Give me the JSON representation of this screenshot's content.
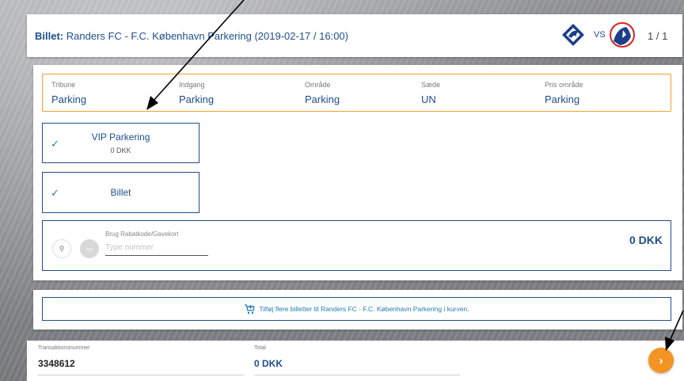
{
  "header": {
    "label": "Billet:",
    "event": "Randers FC - F.C. København Parkering (2019-02-17 / 16:00)",
    "vs": "VS",
    "page_count": "1 / 1"
  },
  "info": [
    {
      "label": "Tribune",
      "value": "Parking"
    },
    {
      "label": "Indgang",
      "value": "Parking"
    },
    {
      "label": "Område",
      "value": "Parking"
    },
    {
      "label": "Sæde",
      "value": "UN"
    },
    {
      "label": "Pris område",
      "value": "Parking"
    }
  ],
  "options": [
    {
      "name": "VIP Parkering",
      "price": "0 DKK"
    },
    {
      "name": "Billet"
    }
  ],
  "discount": {
    "label": "Brug Rabatkode/Gavekort",
    "placeholder": "Type nummer",
    "total": "0 DKK"
  },
  "add_more": {
    "text": "Tilføj flere billetter til Randers FC - F.C. København Parkering i kurven."
  },
  "footer": {
    "transaction_label": "Transaktionsnummer",
    "transaction_value": "3348612",
    "total_label": "Total",
    "total_value": "0 DKK"
  },
  "colors": {
    "accent": "#1f4e8c",
    "link": "#1f7ab8",
    "info_border": "#f0a030",
    "next_button": "#f39423"
  },
  "icons": {
    "check": "check-icon",
    "cart": "cart-add-icon",
    "next": "chevron-right-icon",
    "user": "user-icon",
    "card": "card-icon"
  }
}
